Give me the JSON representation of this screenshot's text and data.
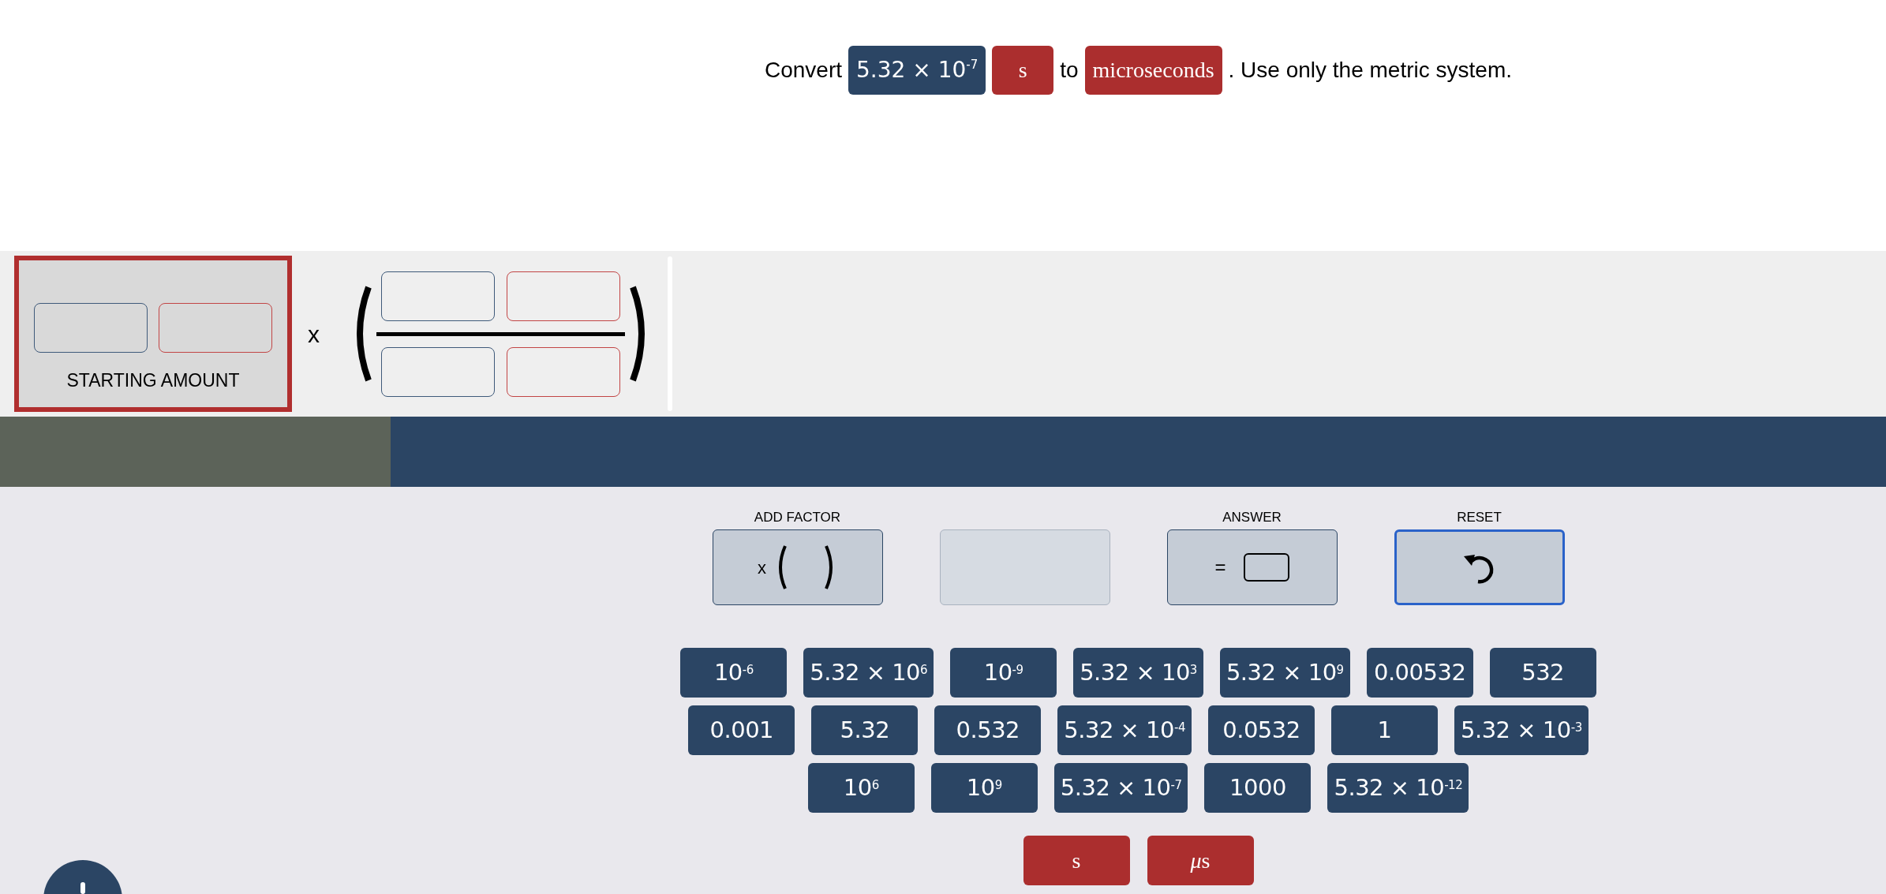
{
  "prompt": [
    {
      "kind": "text",
      "text": "Convert"
    },
    {
      "kind": "number",
      "text": "5.32 × 10$^{-7}$"
    },
    {
      "kind": "unit",
      "text": "s"
    },
    {
      "kind": "text",
      "text": "to"
    },
    {
      "kind": "unit",
      "text": "microseconds"
    },
    {
      "kind": "text",
      "text": ". Use only the metric system."
    }
  ],
  "starting_amount": {
    "label": "STARTING AMOUNT",
    "selected": true
  },
  "factor_operator": "x",
  "progress": {
    "level": 0.207
  },
  "controls": [
    {
      "kind": "add_factor",
      "label": "ADD FACTOR",
      "symbol": "x",
      "disabled": false,
      "selected": false
    },
    {
      "kind": "blank",
      "disabled": true,
      "selected": false
    },
    {
      "kind": "answer",
      "label": "ANSWER",
      "symbol": "=",
      "disabled": false,
      "selected": false
    },
    {
      "kind": "reset",
      "label": "RESET",
      "disabled": false,
      "selected": true
    }
  ],
  "tile_rows": [
    [
      "10$^{-6}$",
      "5.32 × 10$^{6}$",
      "10$^{-9}$",
      "5.32 × 10$^{3}$",
      "5.32 × 10$^{9}$",
      "0.00532",
      "532"
    ],
    [
      "0.001",
      "5.32",
      "0.532",
      "5.32 × 10$^{-4}$",
      "0.0532",
      "1",
      "5.32 × 10$^{-3}$"
    ],
    [
      "10$^{6}$",
      "10$^{9}$",
      "5.32 × 10$^{-7}$",
      "1000",
      "5.32 × 10$^{-12}$"
    ]
  ],
  "unit_tiles": [
    {
      "unit": "s"
    },
    {
      "prefix": "μ",
      "unit": "s"
    }
  ]
}
